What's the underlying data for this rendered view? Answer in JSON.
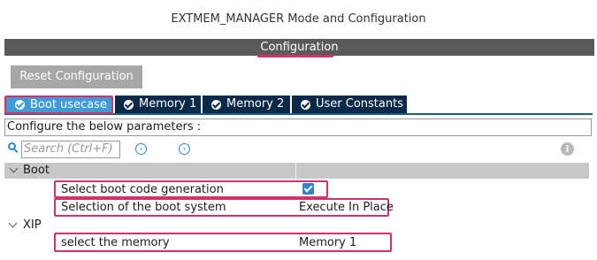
{
  "window": {
    "title": "EXTMEM_MANAGER Mode and Configuration"
  },
  "config_bar": {
    "label": "Configuration"
  },
  "toolbar": {
    "reset_label": "Reset Configuration"
  },
  "tabs": [
    {
      "label": "Boot usecase",
      "active": true
    },
    {
      "label": "Memory 1",
      "active": false
    },
    {
      "label": "Memory 2",
      "active": false
    },
    {
      "label": "User Constants",
      "active": false
    }
  ],
  "params": {
    "header": "Configure the below parameters :"
  },
  "search": {
    "placeholder": "Search (Ctrl+F)"
  },
  "groups": {
    "boot": {
      "label": "Boot",
      "rows": [
        {
          "label": "Select boot code generation",
          "value": "",
          "checked": true
        },
        {
          "label": "Selection of the boot system",
          "value": "Execute In Place"
        }
      ]
    },
    "xip": {
      "label": "XIP",
      "rows": [
        {
          "label": "select the memory",
          "value": "Memory 1"
        }
      ]
    }
  },
  "colors": {
    "highlight": "#d4306b",
    "tab_active": "#3d9bd6",
    "tab_inactive": "#0b2a47",
    "accent": "#2f87c6"
  },
  "icons": {
    "tab": "check-circle-icon",
    "search": "search-icon",
    "prev": "chevron-left-circle-icon",
    "next": "chevron-right-circle-icon",
    "info": "info-icon",
    "group_toggle": "chevron-down-icon"
  }
}
